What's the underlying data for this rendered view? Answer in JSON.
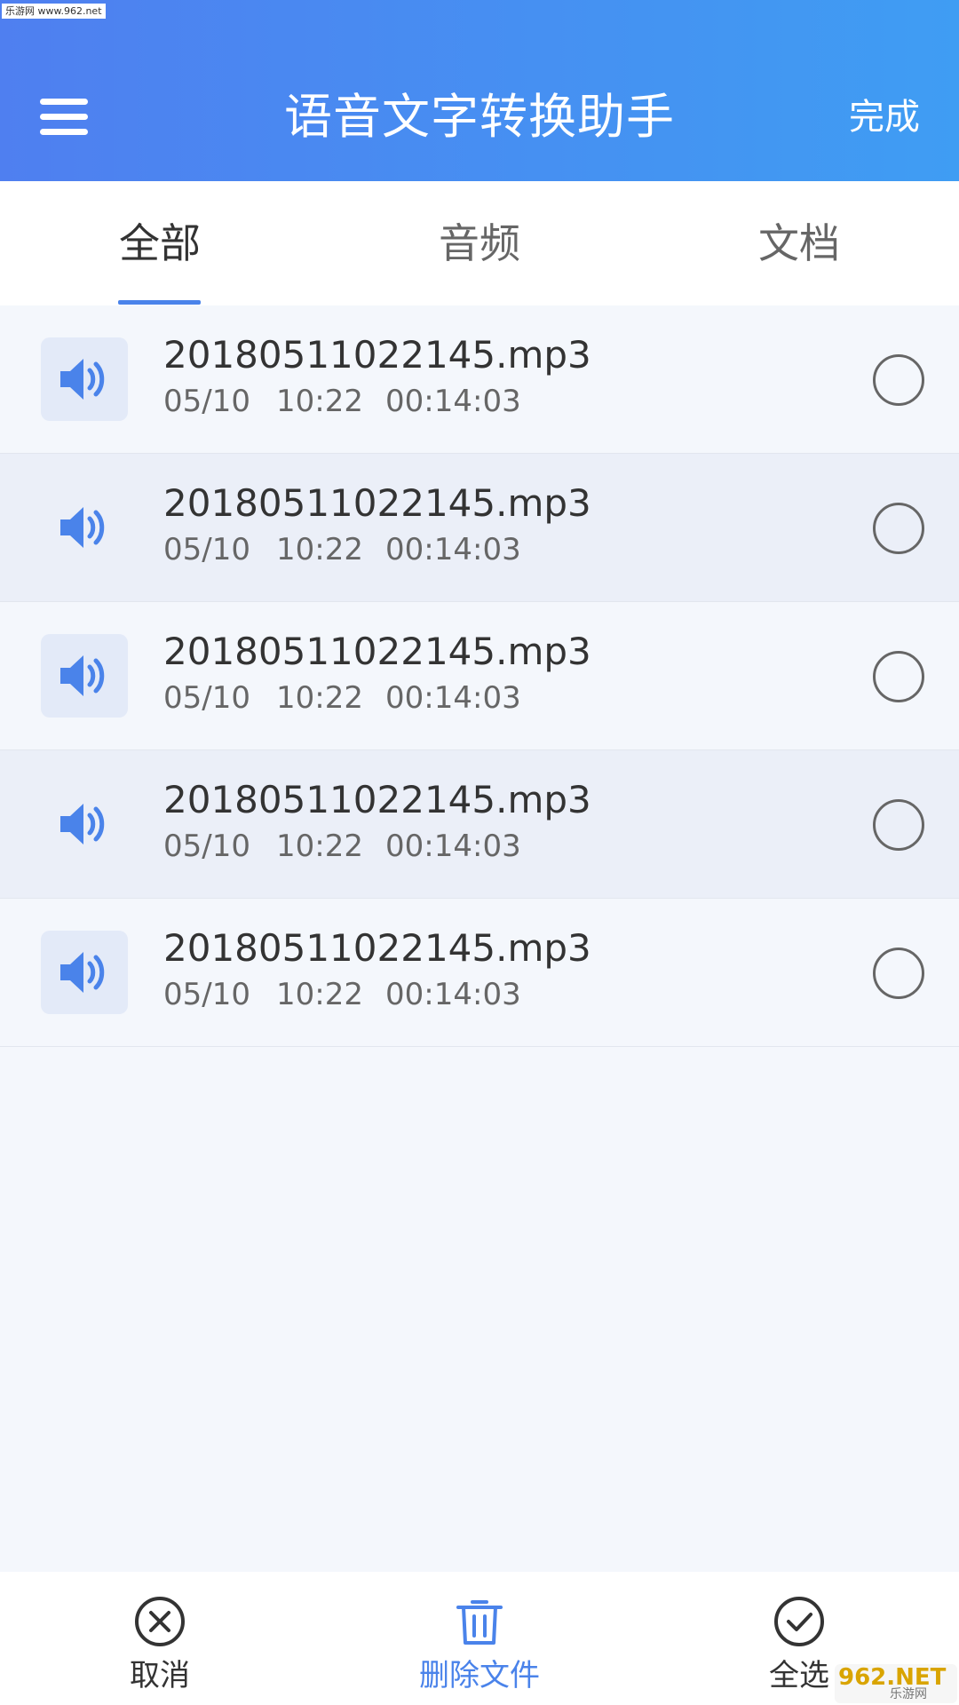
{
  "watermark_top": "乐游网 www.962.net",
  "header": {
    "title": "语音文字转换助手",
    "done_label": "完成"
  },
  "tabs": [
    {
      "label": "全部",
      "active": true
    },
    {
      "label": "音频",
      "active": false
    },
    {
      "label": "文档",
      "active": false
    }
  ],
  "files": [
    {
      "name": "20180511022145.mp3",
      "date": "05/10",
      "time": "10:22",
      "duration": "00:14:03",
      "selected": false
    },
    {
      "name": "20180511022145.mp3",
      "date": "05/10",
      "time": "10:22",
      "duration": "00:14:03",
      "selected": false
    },
    {
      "name": "20180511022145.mp3",
      "date": "05/10",
      "time": "10:22",
      "duration": "00:14:03",
      "selected": false
    },
    {
      "name": "20180511022145.mp3",
      "date": "05/10",
      "time": "10:22",
      "duration": "00:14:03",
      "selected": false
    },
    {
      "name": "20180511022145.mp3",
      "date": "05/10",
      "time": "10:22",
      "duration": "00:14:03",
      "selected": false
    }
  ],
  "bottom_bar": {
    "cancel_label": "取消",
    "delete_label": "删除文件",
    "select_all_label": "全选"
  },
  "watermark_br": {
    "main": "962.NET",
    "sub": "乐游网"
  },
  "colors": {
    "accent": "#4a83ea",
    "header_start": "#4f7ff0",
    "header_end": "#3f9df3",
    "speaker_icon": "#4a83ea"
  },
  "icons": {
    "menu": "hamburger-menu-icon",
    "file": "speaker-icon",
    "cancel": "close-circle-icon",
    "delete": "trash-icon",
    "select_all": "check-circle-icon"
  }
}
